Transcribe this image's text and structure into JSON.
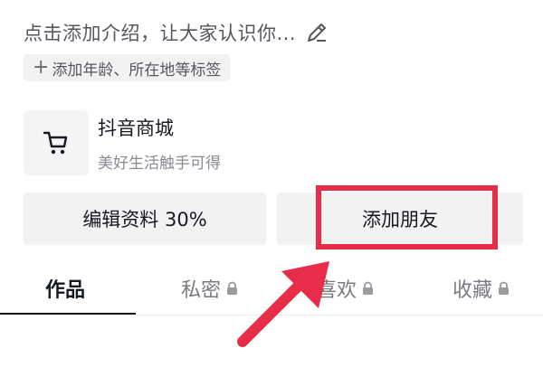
{
  "profile": {
    "bio_placeholder": "点击添加介绍，让大家认识你...",
    "tag_button_label": "添加年龄、所在地等标签"
  },
  "shop": {
    "title": "抖音商城",
    "subtitle": "美好生活触手可得"
  },
  "actions": {
    "edit_profile": "编辑资料 30%",
    "add_friends": "添加朋友"
  },
  "tabs": [
    {
      "label": "作品",
      "locked": false,
      "active": true
    },
    {
      "label": "私密",
      "locked": true,
      "active": false
    },
    {
      "label": "喜欢",
      "locked": true,
      "active": false
    },
    {
      "label": "收藏",
      "locked": true,
      "active": false
    }
  ],
  "colors": {
    "annotation_red": "#e72d49",
    "text_primary": "#161823",
    "text_secondary": "#55575f",
    "button_bg": "#f2f2f3"
  },
  "icons": {
    "edit": "pencil-icon",
    "shop": "shopping-cart-icon",
    "tag_add": "plus-icon",
    "lock": "lock-icon"
  }
}
